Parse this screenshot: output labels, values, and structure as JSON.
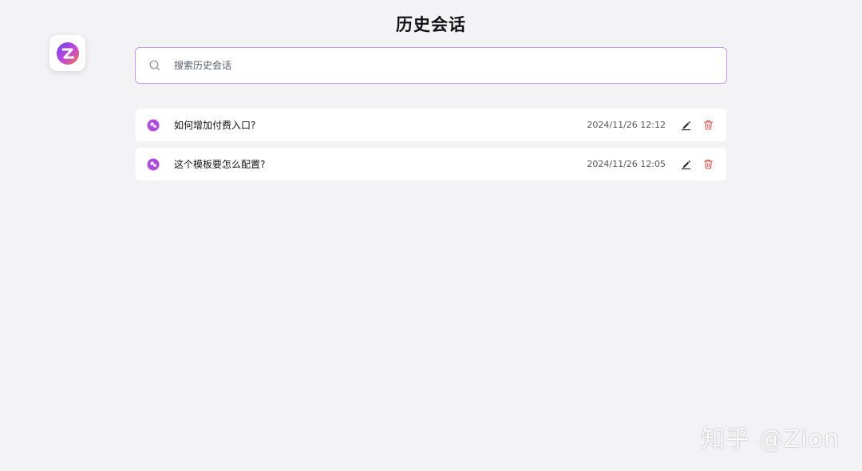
{
  "header": {
    "title": "历史会话"
  },
  "logo": {
    "icon": "zion-logo-icon"
  },
  "search": {
    "placeholder": "搜索历史会话",
    "value": ""
  },
  "conversations": [
    {
      "title": "如何增加付费入口?",
      "time": "2024/11/26 12:12",
      "icon": "chat-bubble-icon"
    },
    {
      "title": "这个模板要怎么配置?",
      "time": "2024/11/26 12:05",
      "icon": "chat-bubble-icon"
    }
  ],
  "colors": {
    "accent": "#b04be0",
    "delete": "#d9534f",
    "search_border": "#c79cf0",
    "background": "#f3f3f6"
  },
  "watermark": {
    "text": "知乎 @Zion"
  }
}
